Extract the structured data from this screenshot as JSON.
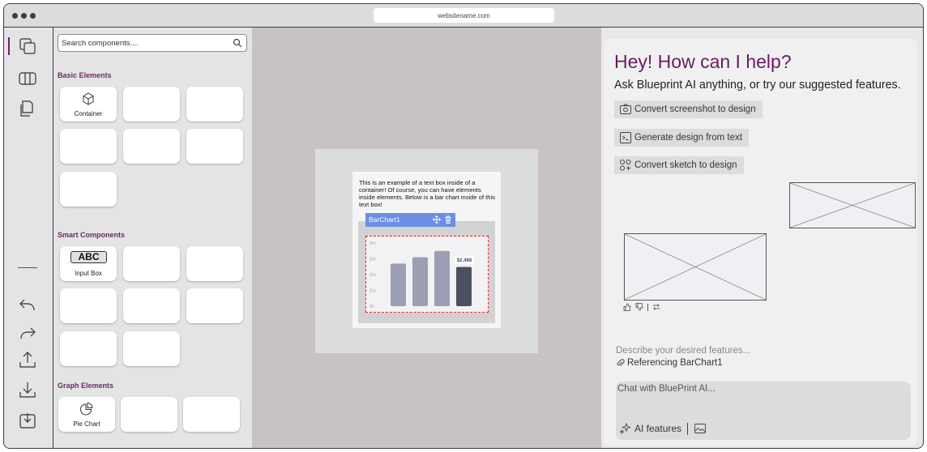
{
  "browser": {
    "url": "websitename.com"
  },
  "panel": {
    "search_placeholder": "Search components....",
    "sections": {
      "basic": "Basic Elements",
      "smart": "Smart Components",
      "graph": "Graph Elements"
    },
    "tiles": {
      "container": "Container",
      "input_box_glyph": "ABC",
      "input_box": "Input Box",
      "pie_chart": "Pie Chart"
    }
  },
  "canvas": {
    "textbox_copy": "This is an example of a text box inside of a container! Of course, you can have elements inside elements. Below is a bar chart inside of this text box!",
    "chart_chip": "BarChart1"
  },
  "chart_data": {
    "type": "bar",
    "categories": [
      "",
      "",
      "",
      ""
    ],
    "values": [
      2.7,
      3.1,
      3.5,
      2.488
    ],
    "y_ticks": [
      "$4k",
      "$3k",
      "$2k",
      "$1k",
      "$0"
    ],
    "ylim": [
      0,
      4
    ],
    "data_labels": [
      "",
      "",
      "",
      "$2.488"
    ],
    "colors": [
      "#9aa0b2",
      "#9aa0b2",
      "#9aa0b2",
      "#4a5060"
    ],
    "grid": false
  },
  "assistant": {
    "greeting": "Hey! How can I help?",
    "subtitle": "Ask Blueprint AI anything, or try our suggested features.",
    "suggestions": [
      "Convert screenshot to design",
      "Generate design from text",
      "Convert sketch to design"
    ],
    "describe_hint": "Describe your desired features...",
    "reference": "Referencing BarChart1",
    "chat_placeholder": "Chat with BluePrint AI...",
    "ai_features": "AI features"
  }
}
